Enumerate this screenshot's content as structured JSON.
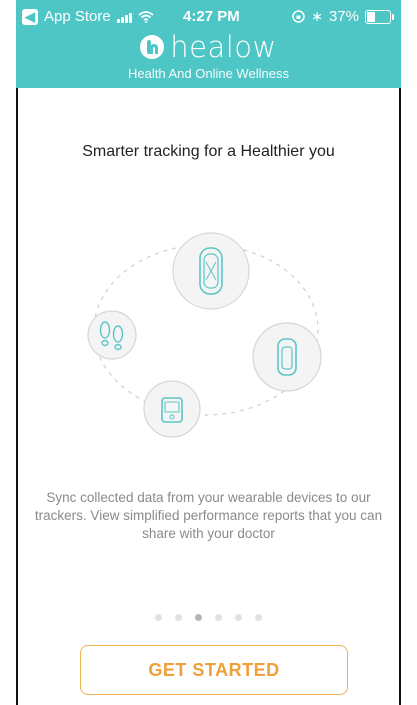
{
  "status_bar": {
    "back_app": "App Store",
    "time": "4:27 PM",
    "battery": "37%",
    "battery_level": 0.37
  },
  "brand": {
    "name": "healow",
    "tagline": "Health And Online Wellness"
  },
  "onboarding": {
    "headline": "Smarter tracking for a Healthier you",
    "description": "Sync collected data from your wearable devices to our trackers. View simplified performance reports that you can share with your doctor",
    "pages_total": 6,
    "current_page": 3,
    "cta_label": "GET STARTED"
  },
  "colors": {
    "header": "#4fc6c6",
    "accent": "#f0a03a",
    "icon_stroke": "#5cc6c6"
  },
  "icons": [
    "wristband-icon",
    "phone-tracker-icon",
    "device-icon",
    "footsteps-icon"
  ]
}
